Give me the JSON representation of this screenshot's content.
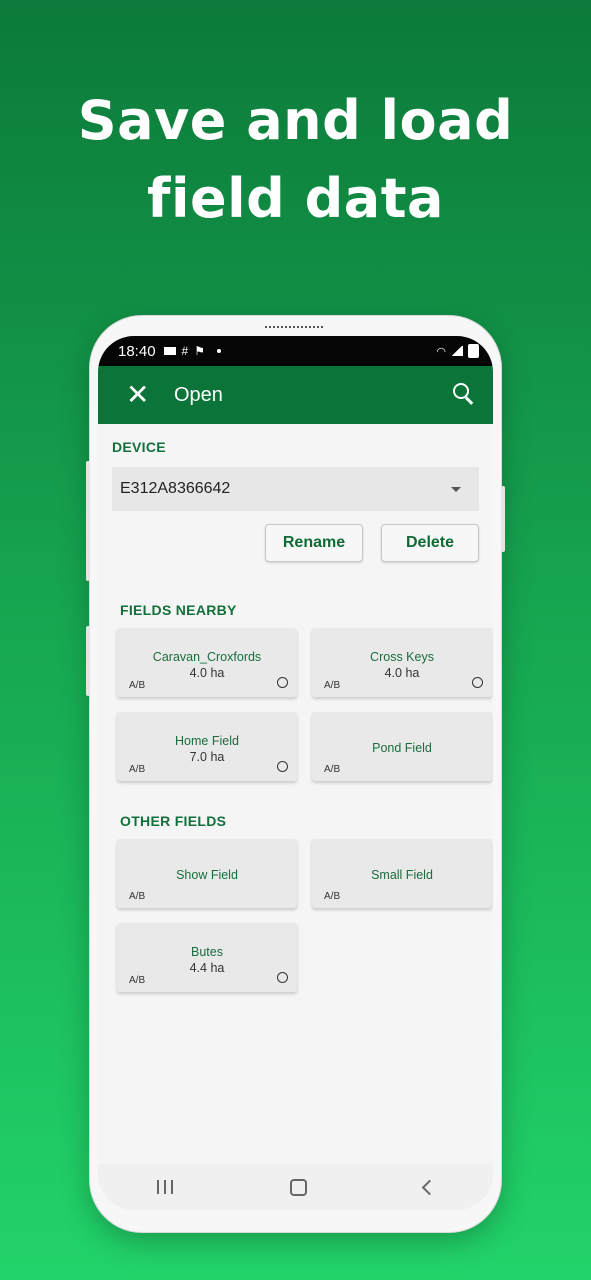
{
  "headline": {
    "line1": "Save and load",
    "line2": "field data"
  },
  "status_bar": {
    "time": "18:40"
  },
  "app_bar": {
    "title": "Open"
  },
  "device_section": {
    "label": "DEVICE",
    "selected_device": "E312A8366642",
    "rename_label": "Rename",
    "delete_label": "Delete"
  },
  "fields_nearby": {
    "label": "FIELDS NEARBY",
    "items": [
      {
        "name": "Caravan_Croxfords",
        "area": "4.0 ha",
        "tag": "A/B"
      },
      {
        "name": "Cross Keys",
        "area": "4.0 ha",
        "tag": "A/B"
      },
      {
        "name": "Home Field",
        "area": "7.0 ha",
        "tag": "A/B"
      },
      {
        "name": "Pond Field",
        "area": "",
        "tag": "A/B"
      }
    ]
  },
  "other_fields": {
    "label": "OTHER FIELDS",
    "items": [
      {
        "name": "Show Field",
        "area": "",
        "tag": "A/B"
      },
      {
        "name": "Small Field",
        "area": "",
        "tag": "A/B"
      },
      {
        "name": "Butes",
        "area": "4.4 ha",
        "tag": "A/B"
      }
    ]
  },
  "colors": {
    "app_bar": "#0b7438",
    "accent_text": "#12703a",
    "background_gradient_top": "#0c7a3a",
    "background_gradient_bottom": "#22d36a"
  }
}
